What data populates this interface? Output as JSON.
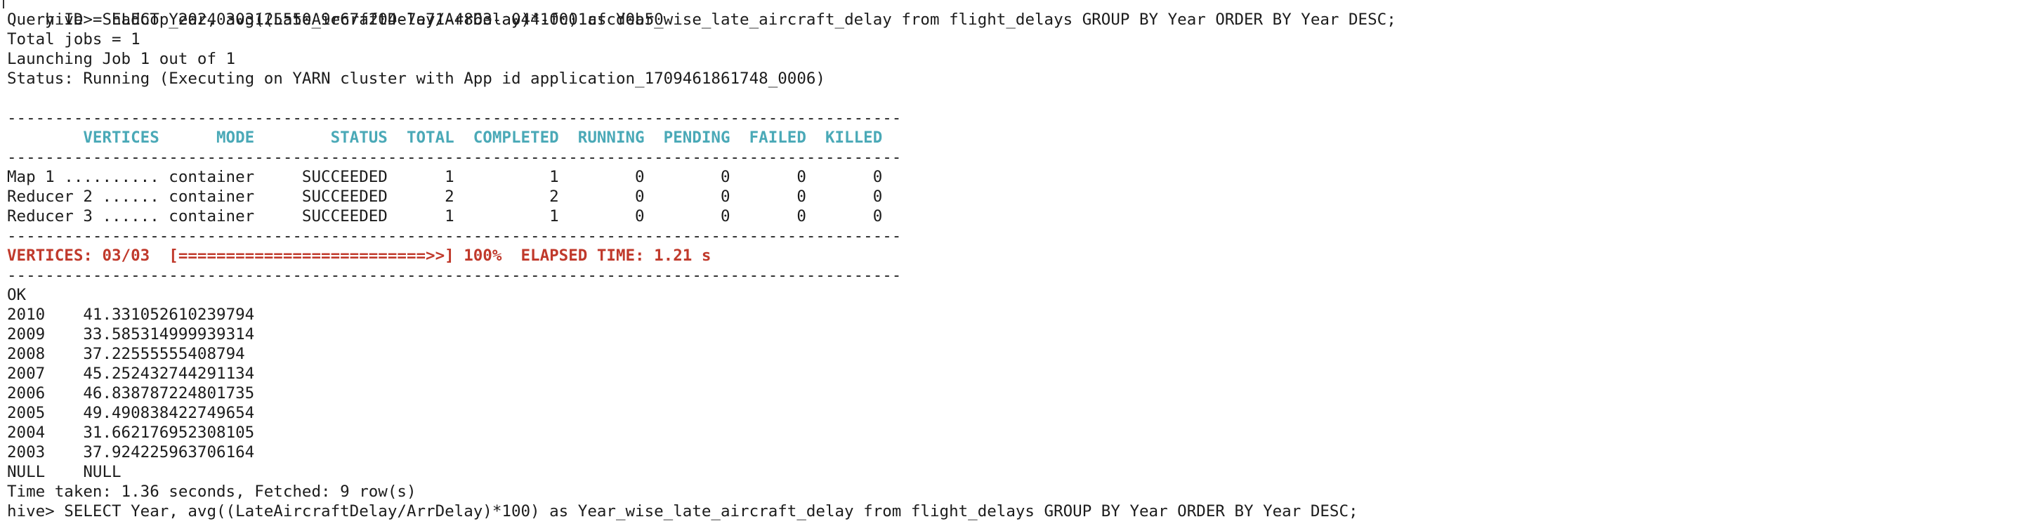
{
  "colors": {
    "background": "#ffffff",
    "text": "#1c1c1c",
    "header": "#4aa9b7",
    "progress": "#c0392b"
  },
  "terminal": {
    "command_line": "hive> SELECT Year, avg((LateAircraftDelay/ArrDelay)*100) as Year_wise_late_aircraft_delay from flight_delays GROUP BY Year ORDER BY Year DESC;",
    "query_id": "Query ID = hadoop_20240303125550_9e67f204-7e71-4863-a044-fc01cfcd0b50",
    "total_jobs": "Total jobs = 1",
    "launching": "Launching Job 1 out of 1",
    "status": "Status: Running (Executing on YARN cluster with App id application_1709461861748_0006)",
    "blank": "",
    "divider": "----------------------------------------------------------------------------------------------",
    "dag_table": {
      "header": "        VERTICES      MODE        STATUS  TOTAL  COMPLETED  RUNNING  PENDING  FAILED  KILLED  ",
      "rows": [
        "Map 1 .......... container     SUCCEEDED      1          1        0        0       0       0  ",
        "Reducer 2 ...... container     SUCCEEDED      2          2        0        0       0       0  ",
        "Reducer 3 ...... container     SUCCEEDED      1          1        0        0       0       0  "
      ]
    },
    "progress": "VERTICES: 03/03  [==========================>>] 100%  ELAPSED TIME: 1.21 s",
    "ok": "OK",
    "results": [
      "2010\t41.331052610239794",
      "2009\t33.585314999939314",
      "2008\t37.22555555408794",
      "2007\t45.252432744291134",
      "2006\t46.838787224801735",
      "2005\t49.490838422749654",
      "2004\t31.662176952308105",
      "2003\t37.924225963706164",
      "NULL\tNULL"
    ],
    "time_taken": "Time taken: 1.36 seconds, Fetched: 9 row(s)",
    "next_prompt": "hive> SELECT Year, avg((LateAircraftDelay/ArrDelay)*100) as Year_wise_late_aircraft_delay from flight_delays GROUP BY Year ORDER BY Year DESC;"
  }
}
